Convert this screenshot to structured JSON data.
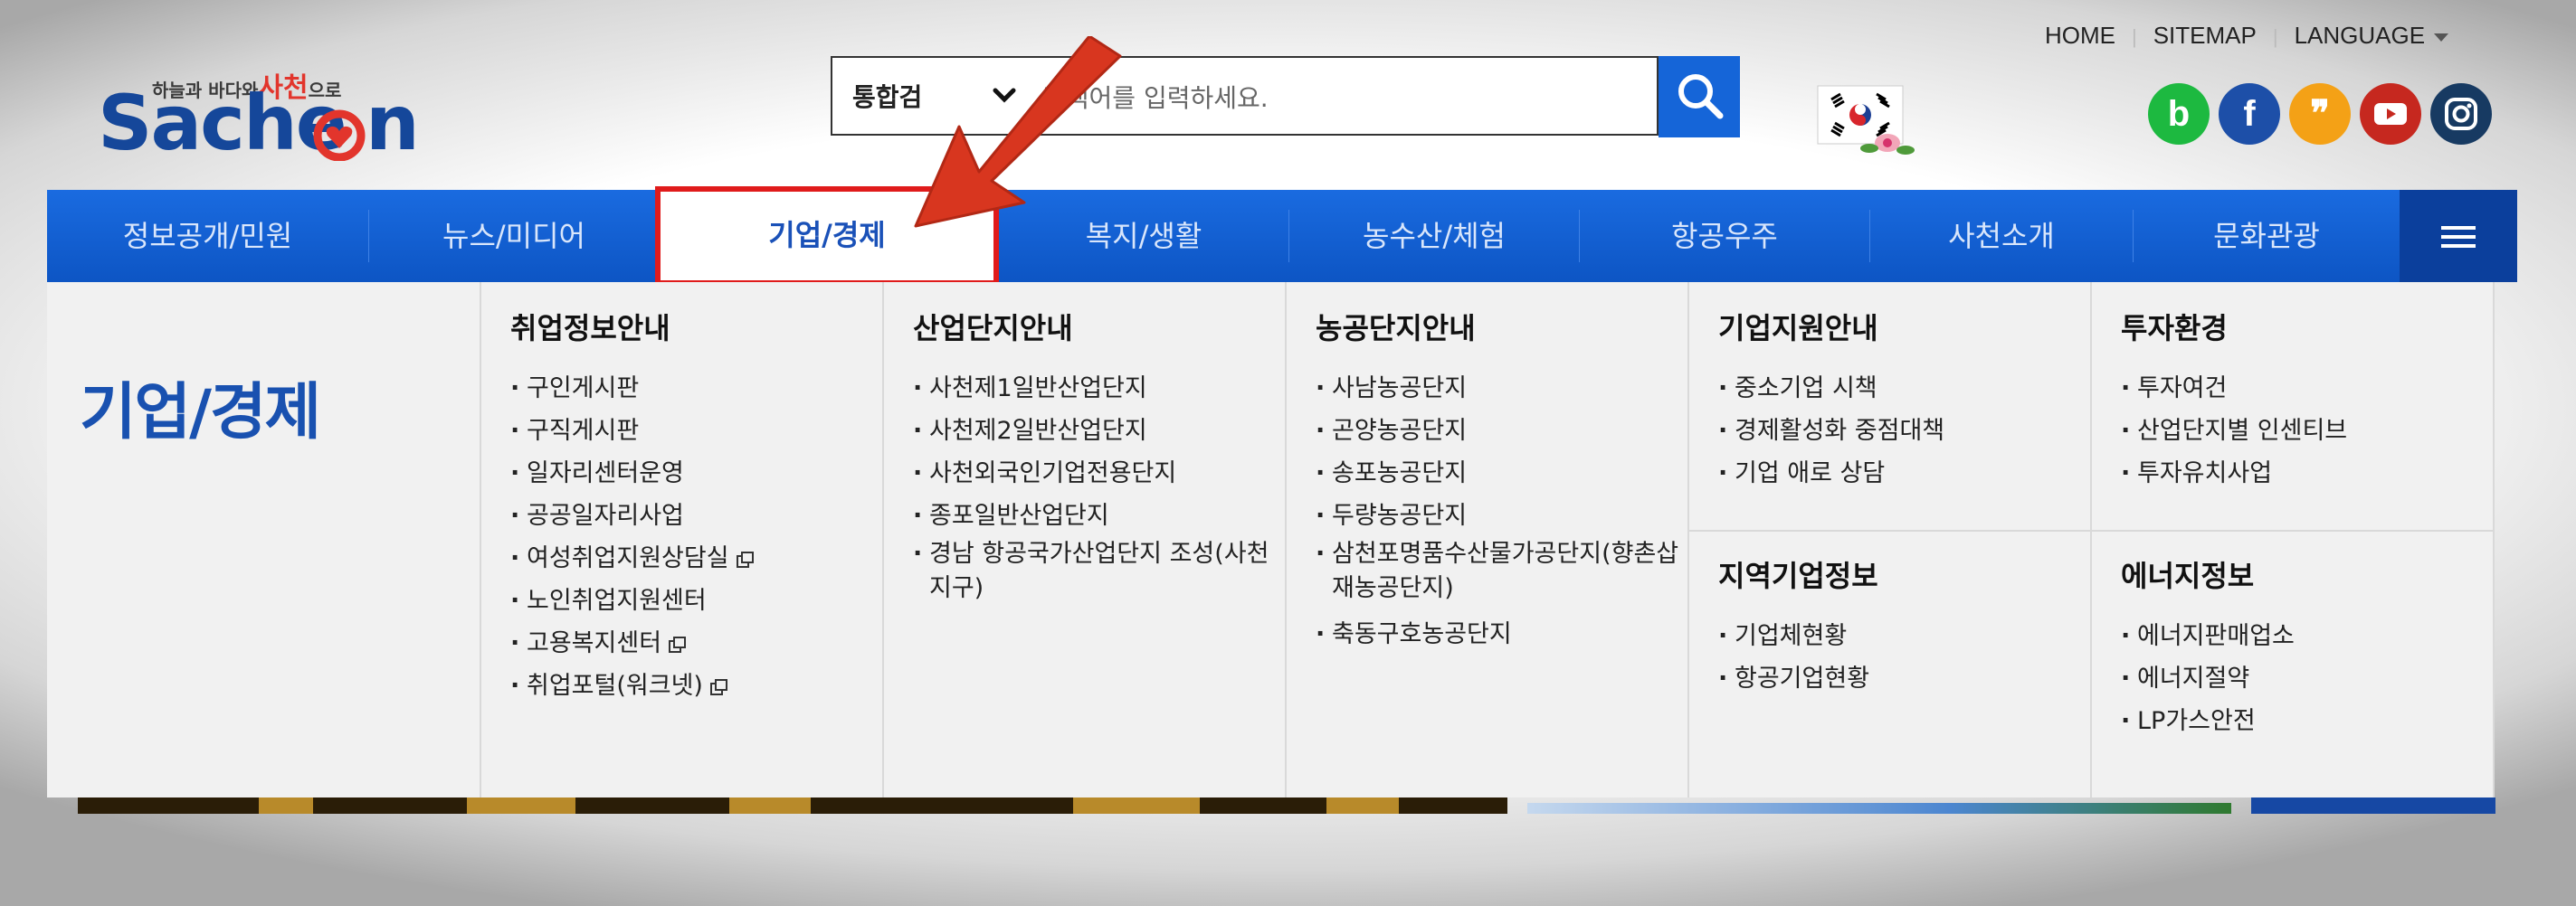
{
  "header": {
    "logo": {
      "slogan_prefix": "하늘과 바다와",
      "slogan_red": "사천",
      "slogan_suffix": "으로",
      "wordmark_left": "Sache",
      "wordmark_right": "n"
    },
    "search": {
      "select_label": "통합검",
      "placeholder": "검색어를 입력하세요."
    },
    "top_links": [
      "HOME",
      "SITEMAP",
      "LANGUAGE"
    ],
    "social": [
      {
        "name": "band",
        "glyph": "b"
      },
      {
        "name": "facebook",
        "glyph": "f"
      },
      {
        "name": "kakaotalk",
        "glyph": "❞"
      },
      {
        "name": "youtube",
        "glyph": "You Tube"
      },
      {
        "name": "instagram",
        "glyph": ""
      }
    ]
  },
  "nav": {
    "items": [
      "정보공개/민원",
      "뉴스/미디어",
      "기업/경제",
      "복지/생활",
      "농수산/체험",
      "항공우주",
      "사천소개",
      "문화관광"
    ],
    "active_index": 2
  },
  "dropdown": {
    "title": "기업/경제",
    "columns": [
      {
        "heading": "취업정보안내",
        "items": [
          {
            "label": "구인게시판",
            "external": false
          },
          {
            "label": "구직게시판",
            "external": false
          },
          {
            "label": "일자리센터운영",
            "external": false
          },
          {
            "label": "공공일자리사업",
            "external": false
          },
          {
            "label": "여성취업지원상담실",
            "external": true
          },
          {
            "label": "노인취업지원센터",
            "external": false
          },
          {
            "label": "고용복지센터",
            "external": true
          },
          {
            "label": "취업포털(워크넷)",
            "external": true
          }
        ]
      },
      {
        "heading": "산업단지안내",
        "items": [
          {
            "label": "사천제1일반산업단지"
          },
          {
            "label": "사천제2일반산업단지"
          },
          {
            "label": "사천외국인기업전용단지"
          },
          {
            "label": "종포일반산업단지"
          },
          {
            "label": "경남 항공국가산업단지 조성(사천지구)"
          }
        ]
      },
      {
        "heading": "농공단지안내",
        "items": [
          {
            "label": "사남농공단지"
          },
          {
            "label": "곤양농공단지"
          },
          {
            "label": "송포농공단지"
          },
          {
            "label": "두량농공단지"
          },
          {
            "label": "삼천포명품수산물가공단지(향촌삽재농공단지)"
          },
          {
            "label": "축동구호농공단지"
          }
        ]
      },
      {
        "heading": "기업지원안내",
        "items": [
          {
            "label": "중소기업 시책"
          },
          {
            "label": "경제활성화 중점대책"
          },
          {
            "label": "기업 애로 상담"
          }
        ]
      },
      {
        "heading": "투자환경",
        "items": [
          {
            "label": "투자여건"
          },
          {
            "label": "산업단지별 인센티브"
          },
          {
            "label": "투자유치사업"
          }
        ]
      },
      {
        "heading": "지역기업정보",
        "items": [
          {
            "label": "기업체현황"
          },
          {
            "label": "항공기업현황"
          }
        ]
      },
      {
        "heading": "에너지정보",
        "items": [
          {
            "label": "에너지판매업소"
          },
          {
            "label": "에너지절약"
          },
          {
            "label": "LP가스안전"
          }
        ]
      }
    ]
  },
  "colors": {
    "brand_blue": "#15479a",
    "nav_blue": "#1565d8",
    "highlight_red": "#e01b1b"
  }
}
